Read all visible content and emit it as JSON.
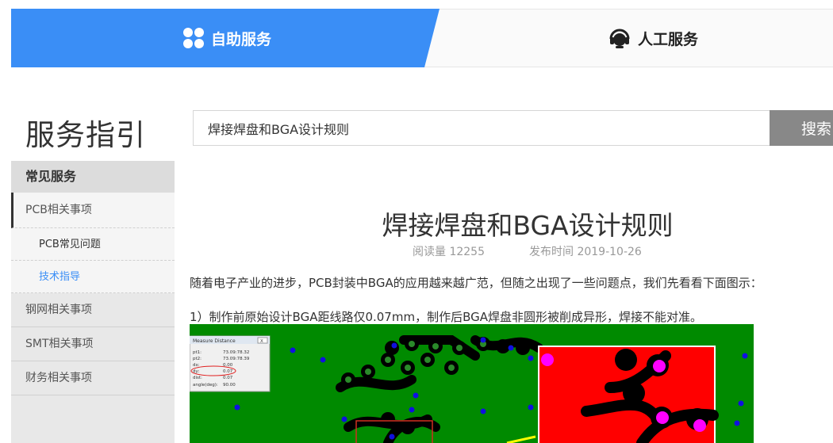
{
  "tabs": {
    "self_service": "自助服务",
    "human_service": "人工服务",
    "active_color": "#3a8ef6"
  },
  "guide": {
    "title": "服务指引"
  },
  "search": {
    "value": "焊接焊盘和BGA设计规则",
    "button": "搜索"
  },
  "sidebar": {
    "header": "常见服务",
    "items": [
      {
        "label": "PCB相关事项",
        "open": true
      },
      {
        "label": "PCB常见问题",
        "sub": true
      },
      {
        "label": "技术指导",
        "sub": true,
        "active": true
      },
      {
        "label": "钢网相关事项"
      },
      {
        "label": "SMT相关事项"
      },
      {
        "label": "财务相关事项"
      }
    ]
  },
  "article": {
    "title": "焊接焊盘和BGA设计规则",
    "views_label": "阅读量",
    "views": "12255",
    "date_label": "发布时间",
    "date": "2019-10-26",
    "para1": "随着电子产业的进步，PCB封装中BGA的应用越来越广范，但随之出现了一些问题点，我们先看看下面图示：",
    "para2": "1）制作前原始设计BGA距线路仅0.07mm，制作后BGA焊盘非圆形被削成异形，焊接不能对准。"
  },
  "figure": {
    "dialog_title": "Measure Distance",
    "dialog_close": "X",
    "rows": [
      {
        "k": "pt1:",
        "v": "73.09:78.32"
      },
      {
        "k": "pt2:",
        "v": "73.09:78.39"
      },
      {
        "k": "dx:",
        "v": "0.00"
      },
      {
        "k": "dy:",
        "v": "0.07"
      },
      {
        "k": "dist:",
        "v": "0.07"
      },
      {
        "k": "angle(deg):",
        "v": "90.00"
      }
    ]
  }
}
